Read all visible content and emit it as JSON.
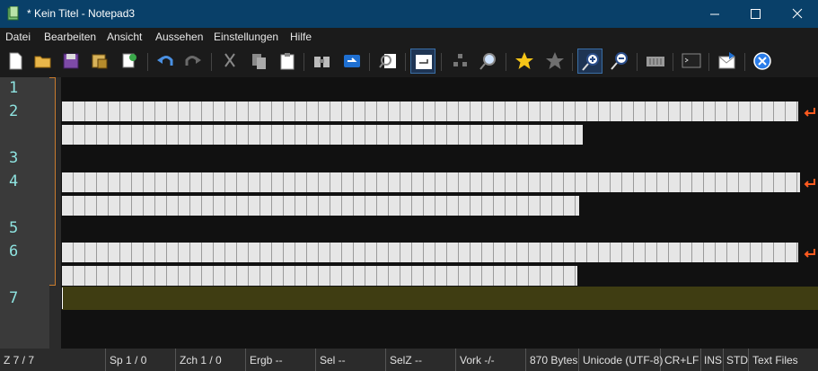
{
  "window": {
    "title": "* Kein Titel - Notepad3",
    "accent": "#094069"
  },
  "menu": [
    "Datei",
    "Bearbeiten",
    "Ansicht",
    "Aussehen",
    "Einstellungen",
    "Hilfe"
  ],
  "toolbar": {
    "buttons": [
      "new-file-icon",
      "open-folder-icon",
      "save-icon",
      "save-as-icon",
      "print-preview-icon",
      "undo-icon",
      "redo-icon",
      "cut-icon",
      "copy-icon",
      "paste-icon",
      "find-icon",
      "replace-icon",
      "find-in-files-icon",
      "word-wrap-icon",
      "fold-icon",
      "zoom-search-icon",
      "bookmark-star-icon",
      "bookmark-clear-icon",
      "zoom-in-icon",
      "zoom-out-icon",
      "encoding-icon",
      "terminal-icon",
      "send-icon",
      "exit-icon"
    ]
  },
  "editor": {
    "line_numbers": [
      "1",
      "2",
      "3",
      "4",
      "5",
      "6",
      "7"
    ],
    "current_line_color": "#3f3d12",
    "wrap_marker_color": "#ff5a1f"
  },
  "status": {
    "line": "Z  7 / 7",
    "col": "Sp  1 / 0",
    "char": "Zch  1 / 0",
    "result": "Ergb  --",
    "sel": "Sel  --",
    "selz": "SelZ  --",
    "occ": "Vork  -/-",
    "size": "870 Bytes",
    "encoding": "Unicode (UTF-8)",
    "eol": "CR+LF",
    "ovr": "INS",
    "mode": "STD",
    "lexer": "Text Files"
  }
}
